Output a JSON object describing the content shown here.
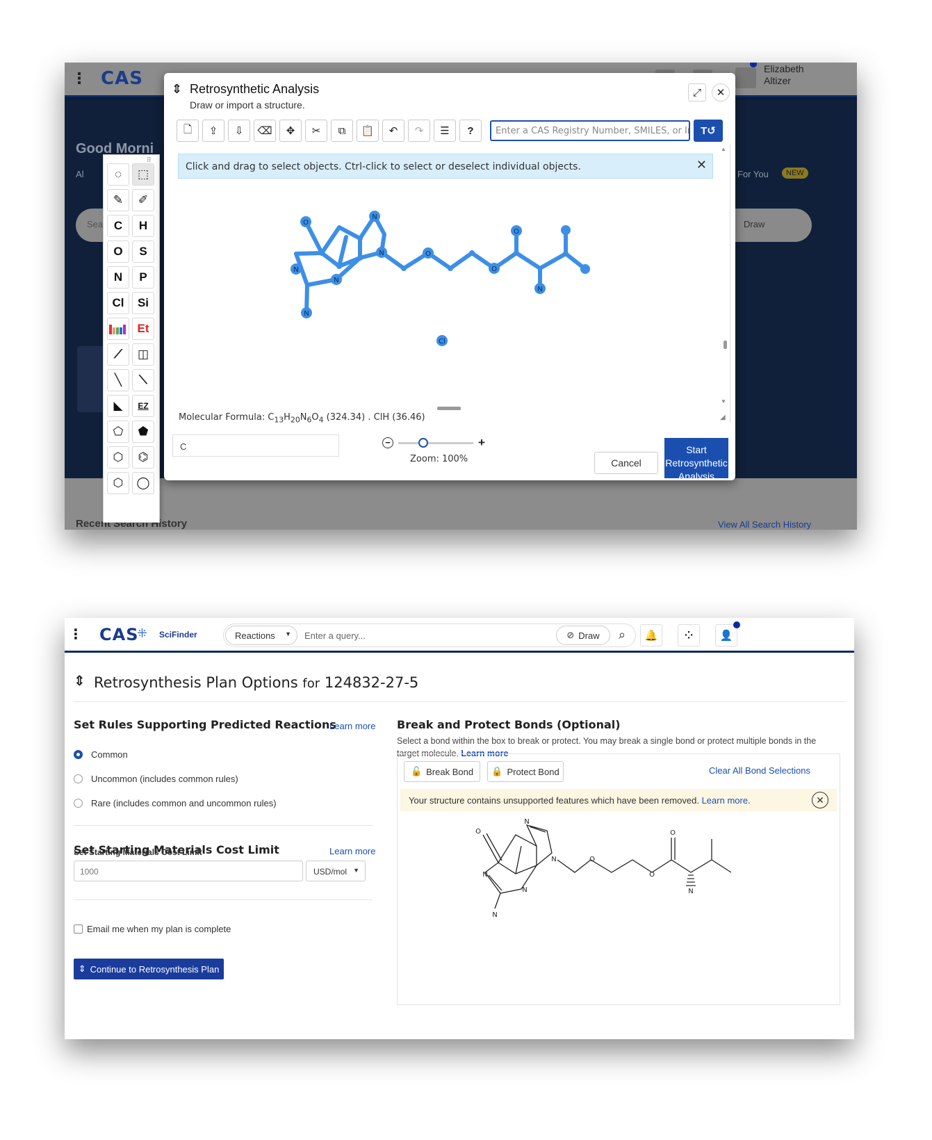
{
  "shot1": {
    "user": {
      "first": "Elizabeth",
      "last": "Altizer"
    },
    "bg_greeting": "Good Morni",
    "bg_tab_all": "Al",
    "bg_for_you": "For You",
    "bg_new_badge": "NEW",
    "bg_search_prefix": "Sea",
    "bg_draw": "Draw",
    "bg_recent": "Recent Search History",
    "bg_view_all": "View All Search History",
    "toolbox": {
      "tools": [
        "C",
        "H",
        "O",
        "S",
        "N",
        "P",
        "Cl",
        "Si",
        "Et",
        "EZ"
      ]
    },
    "dialog": {
      "title": "Retrosynthetic Analysis",
      "subtitle": "Draw or import a structure.",
      "cas_input_placeholder": "Enter a CAS Registry Number, SMILES, or InChI",
      "info_message": "Click and drag to select objects. Ctrl-click to select or deselect individual objects.",
      "formula_prefix": "Molecular Formula: C",
      "formula_c": "13",
      "formula_h_label": "H",
      "formula_h": "20",
      "formula_n_label": "N",
      "formula_n": "6",
      "formula_o_label": "O",
      "formula_o": "4",
      "formula_suffix": " (324.34) . ClH (36.46)",
      "atom_input_value": "C",
      "zoom_label": "Zoom: 100%",
      "zoom_percent": 100,
      "cancel_label": "Cancel",
      "start_label": "Start Retrosynthetic Analysis",
      "atom_labels": [
        "O",
        "N",
        "N",
        "N",
        "N",
        "N",
        "O",
        "O",
        "O",
        "N",
        "Cl"
      ]
    }
  },
  "shot2": {
    "brand": "SciFinder",
    "search_type": "Reactions",
    "search_placeholder": "Enter a query...",
    "draw_label": "Draw",
    "page_title": "Retrosynthesis Plan Options",
    "page_title_for": "for",
    "cas_number": "124832-27-5",
    "rules": {
      "title": "Set Rules Supporting Predicted Reactions",
      "learn_more": "Learn more",
      "options": [
        {
          "label": "Common",
          "selected": true
        },
        {
          "label": "Uncommon (includes common rules)",
          "selected": false
        },
        {
          "label": "Rare (includes common and uncommon rules)",
          "selected": false
        }
      ]
    },
    "cost": {
      "title": "Set Starting Materials Cost Limit",
      "learn_more": "Learn more",
      "field_label": "Set Starting Materials Cost Limit",
      "placeholder": "1000",
      "unit": "USD/mol"
    },
    "email_label": "Email me when my plan is complete",
    "email_checked": false,
    "continue_label": "Continue to Retrosynthesis Plan",
    "bonds": {
      "title": "Break and Protect Bonds (Optional)",
      "description": "Select a bond within the box to break or protect. You may break a single bond or protect multiple bonds in the target molecule.",
      "learn_more": "Learn more",
      "break_label": "Break Bond",
      "protect_label": "Protect Bond",
      "clear_label": "Clear All Bond Selections",
      "warning": "Your structure contains unsupported features which have been removed.",
      "warning_link": "Learn more.",
      "atom_labels": [
        "O",
        "N",
        "N",
        "N",
        "N",
        "N",
        "O",
        "O",
        "O",
        "N"
      ]
    }
  },
  "colors": {
    "accent": "#1a4fb0",
    "nav_border": "#0d2a66",
    "molecule_highlight": "#3d8fe6",
    "info_bg": "#d9eefb",
    "warn_bg": "#fdf6e3"
  }
}
